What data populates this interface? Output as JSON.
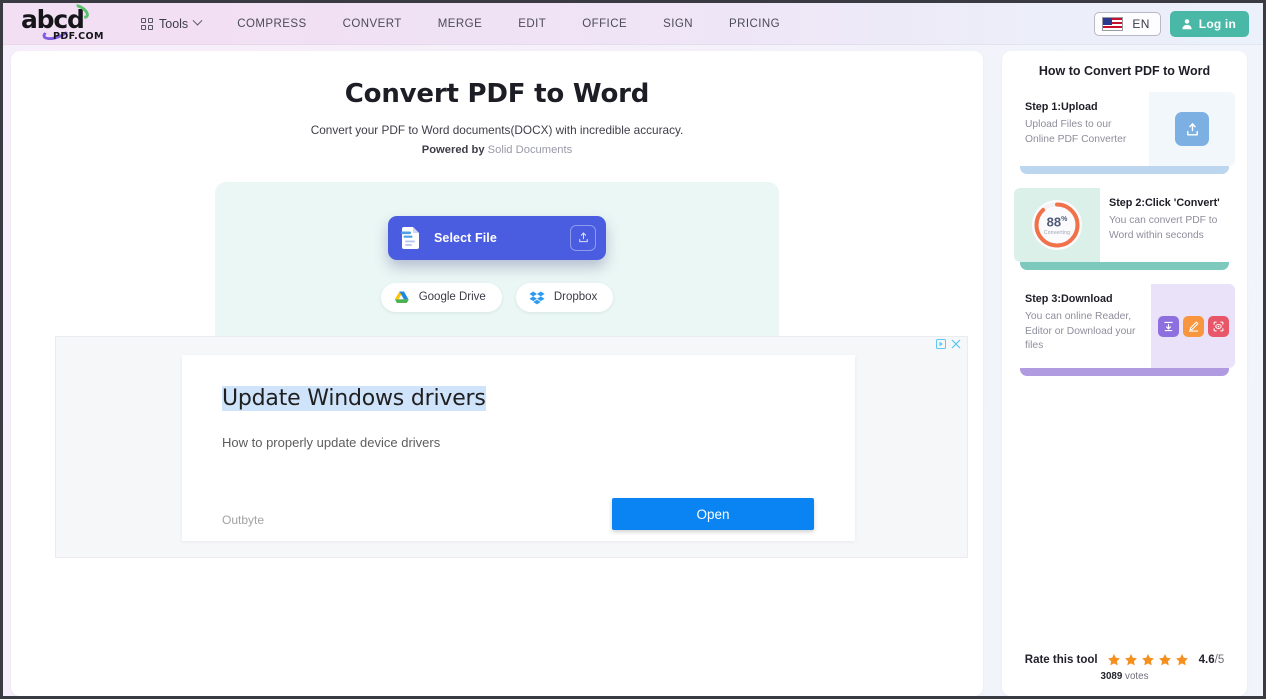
{
  "brand": {
    "logo_word": "abcd",
    "logo_sub": "PDF.COM"
  },
  "header": {
    "tools_label": "Tools",
    "nav": [
      {
        "label": "COMPRESS"
      },
      {
        "label": "CONVERT"
      },
      {
        "label": "MERGE"
      },
      {
        "label": "EDIT"
      },
      {
        "label": "OFFICE"
      },
      {
        "label": "SIGN"
      },
      {
        "label": "PRICING"
      }
    ],
    "language": "EN",
    "login_label": "Log in",
    "login_color": "#49b8a6"
  },
  "hero": {
    "title": "Convert PDF to Word",
    "subtitle": "Convert your PDF to Word documents(DOCX) with incredible accuracy.",
    "powered_prefix": "Powered by",
    "powered_link": "Solid Documents"
  },
  "dropzone": {
    "select_file_label": "Select File",
    "select_file_color": "#4a5ce0",
    "background": "#eaf7f4",
    "cloud_buttons": [
      {
        "label": "Google Drive",
        "icon": "google-drive-icon"
      },
      {
        "label": "Dropbox",
        "icon": "dropbox-icon"
      }
    ]
  },
  "ad": {
    "headline": "Update Windows drivers",
    "description": "How to properly update device drivers",
    "advertiser": "Outbyte",
    "cta_label": "Open",
    "cta_color": "#0b84f3"
  },
  "sidebar": {
    "title": "How to Convert PDF to Word",
    "steps": [
      {
        "heading": "Step 1:Upload",
        "text": "Upload Files to our Online PDF Converter",
        "icon": "upload-icon",
        "accent": "#7cb0e2"
      },
      {
        "heading": "Step 2:Click 'Convert'",
        "text": "You can convert PDF to Word within seconds",
        "icon": "progress-ring-icon",
        "accent": "#7dc9bd",
        "progress_value": "88",
        "progress_unit": "%",
        "progress_label": "Converting",
        "progress_percent": 88,
        "progress_color": "#f0714a"
      },
      {
        "heading": "Step 3:Download",
        "text": "You can online Reader, Editor or Download your files",
        "accent": "#b09be0",
        "actions": [
          {
            "icon": "download-icon",
            "color": "#8d6fe0"
          },
          {
            "icon": "edit-pencil-icon",
            "color": "#f7963f"
          },
          {
            "icon": "view-scan-icon",
            "color": "#e8566a"
          }
        ]
      }
    ],
    "rating": {
      "label": "Rate this tool",
      "stars": 5,
      "star_color": "#f5901e",
      "score": "4.6",
      "scale": "/5",
      "votes_count": "3089",
      "votes_label": "votes"
    }
  }
}
